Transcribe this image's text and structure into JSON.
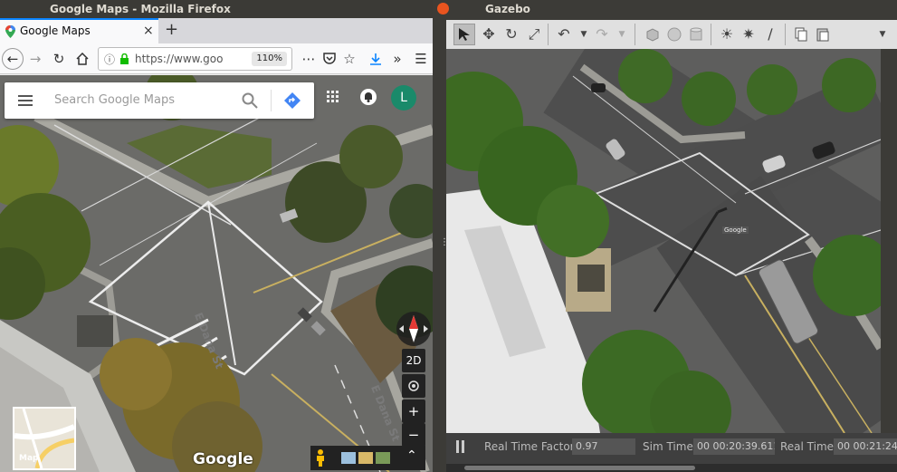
{
  "firefox": {
    "window_title": "Google Maps - Mozilla Firefox",
    "tab_title": "Google Maps",
    "tab_close": "×",
    "new_tab": "+",
    "url": "https://www.goo",
    "zoom": "110%"
  },
  "maps": {
    "search_placeholder": "Search Google Maps",
    "profile_initial": "L",
    "view_2d": "2D",
    "zoom_in": "+",
    "zoom_out": "−",
    "map_type_label": "Map",
    "brand": "Google",
    "street_label_1": "E Dana St",
    "street_label_2": "E Dana St"
  },
  "gazebo": {
    "window_title": "Gazebo",
    "rtf_label": "Real Time Factor:",
    "rtf_value": "0.97",
    "sim_time_label": "Sim Time:",
    "sim_time_value": "00 00:20:39.611",
    "real_time_label": "Real Time:",
    "real_time_value": "00 00:21:24",
    "sign_label": "Google",
    "colors": {
      "close": "#e9541f",
      "toolbar": "#e0e0e0",
      "titlebar": "#3c3b37"
    }
  }
}
